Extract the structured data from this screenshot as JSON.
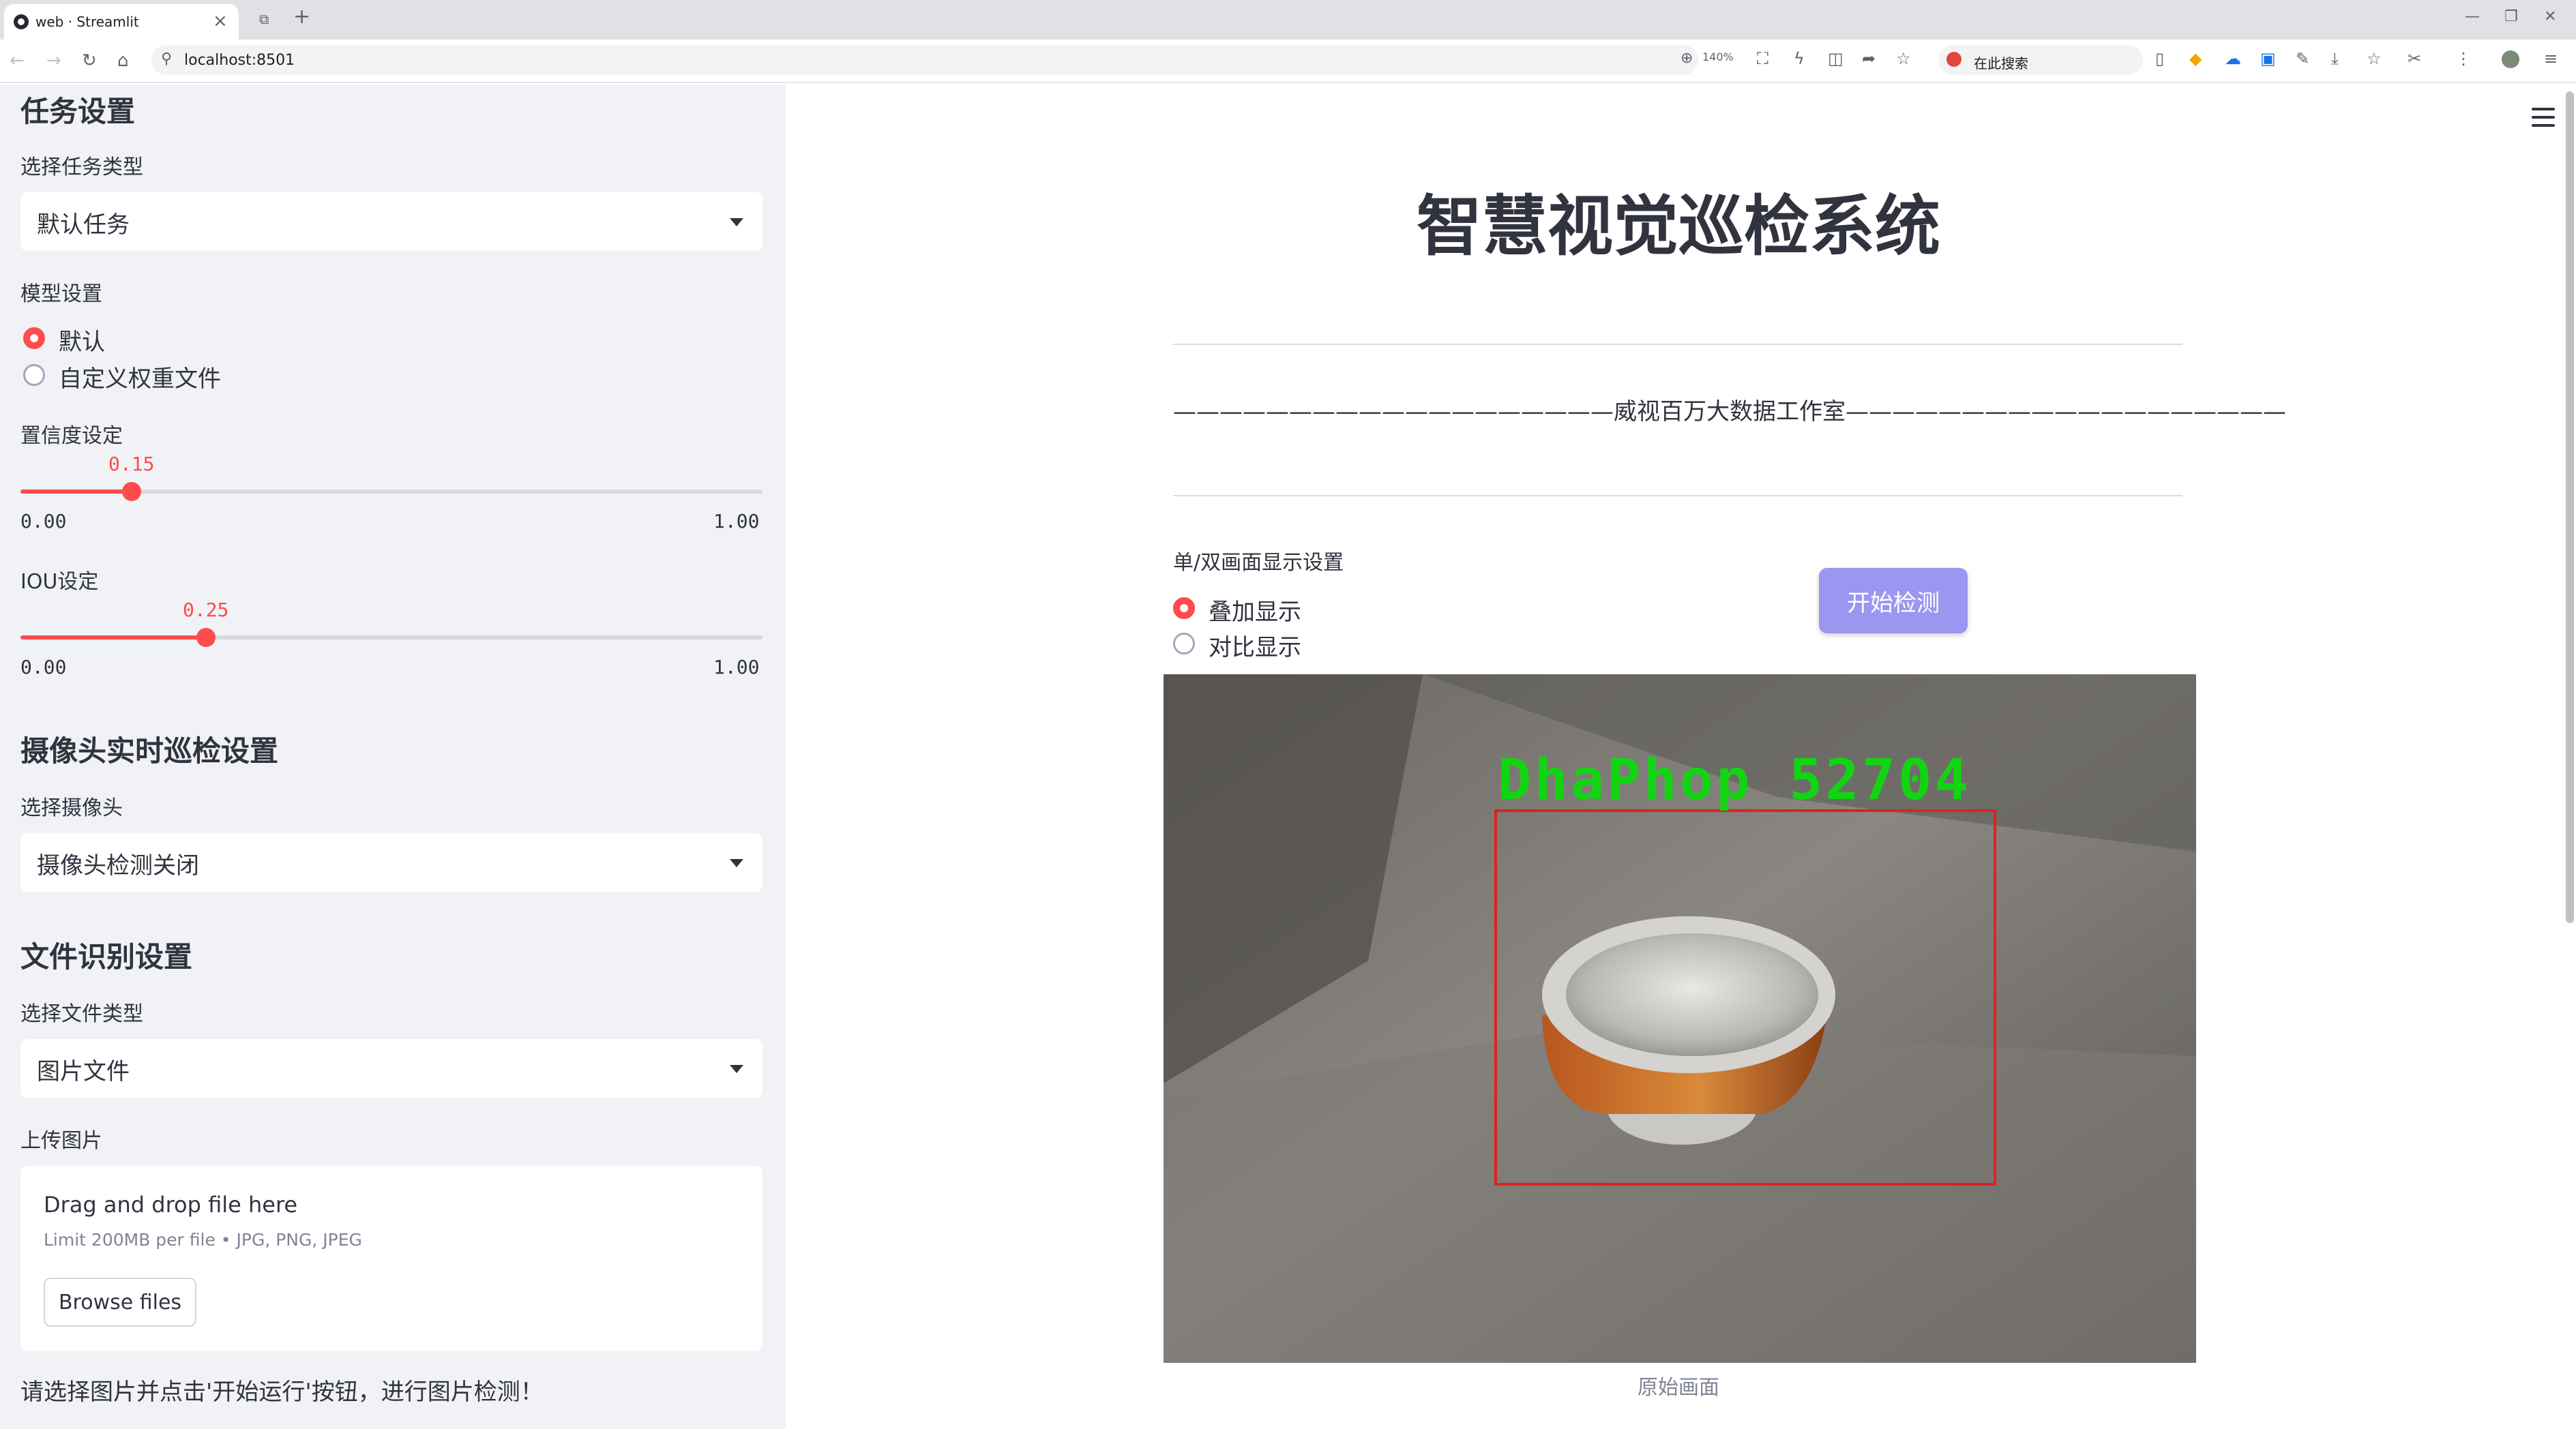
{
  "browser": {
    "tab_title": "web · Streamlit",
    "url": "localhost:8501",
    "zoom": "140%",
    "search_placeholder": "在此搜索"
  },
  "sidebar": {
    "task_section": {
      "heading": "任务设置",
      "select_label": "选择任务类型",
      "select_value": "默认任务"
    },
    "model_section": {
      "label": "模型设置",
      "options": [
        "默认",
        "自定义权重文件"
      ],
      "selected": "默认"
    },
    "confidence": {
      "label": "置信度设定",
      "value": "0.15",
      "min": "0.00",
      "max": "1.00",
      "fraction": 0.15
    },
    "iou": {
      "label": "IOU设定",
      "value": "0.25",
      "min": "0.00",
      "max": "1.00",
      "fraction": 0.25
    },
    "camera_section": {
      "heading": "摄像头实时巡检设置",
      "select_label": "选择摄像头",
      "select_value": "摄像头检测关闭"
    },
    "file_section": {
      "heading": "文件识别设置",
      "select_label": "选择文件类型",
      "select_value": "图片文件",
      "upload_label": "上传图片",
      "drag_text": "Drag and drop file here",
      "limit_text": "Limit 200MB per file • JPG, PNG, JPEG",
      "browse_label": "Browse files"
    },
    "hint": "请选择图片并点击'开始运行'按钮，进行图片检测！"
  },
  "main": {
    "title": "智慧视觉巡检系统",
    "studio_line": "———————————————————威视百万大数据工作室———————————————————",
    "display_mode": {
      "label": "单/双画面显示设置",
      "options": [
        "叠加显示",
        "对比显示"
      ],
      "selected": "叠加显示"
    },
    "start_button": "开始检测",
    "detection_label": "DhaPhop 52704",
    "image_caption": "原始画面"
  },
  "colors": {
    "accent": "#ff4b4b",
    "sidebar_bg": "#f0f2f6",
    "start_button": "#9b96f0",
    "detection_box": "#e0211f",
    "detection_text": "#12d512"
  }
}
